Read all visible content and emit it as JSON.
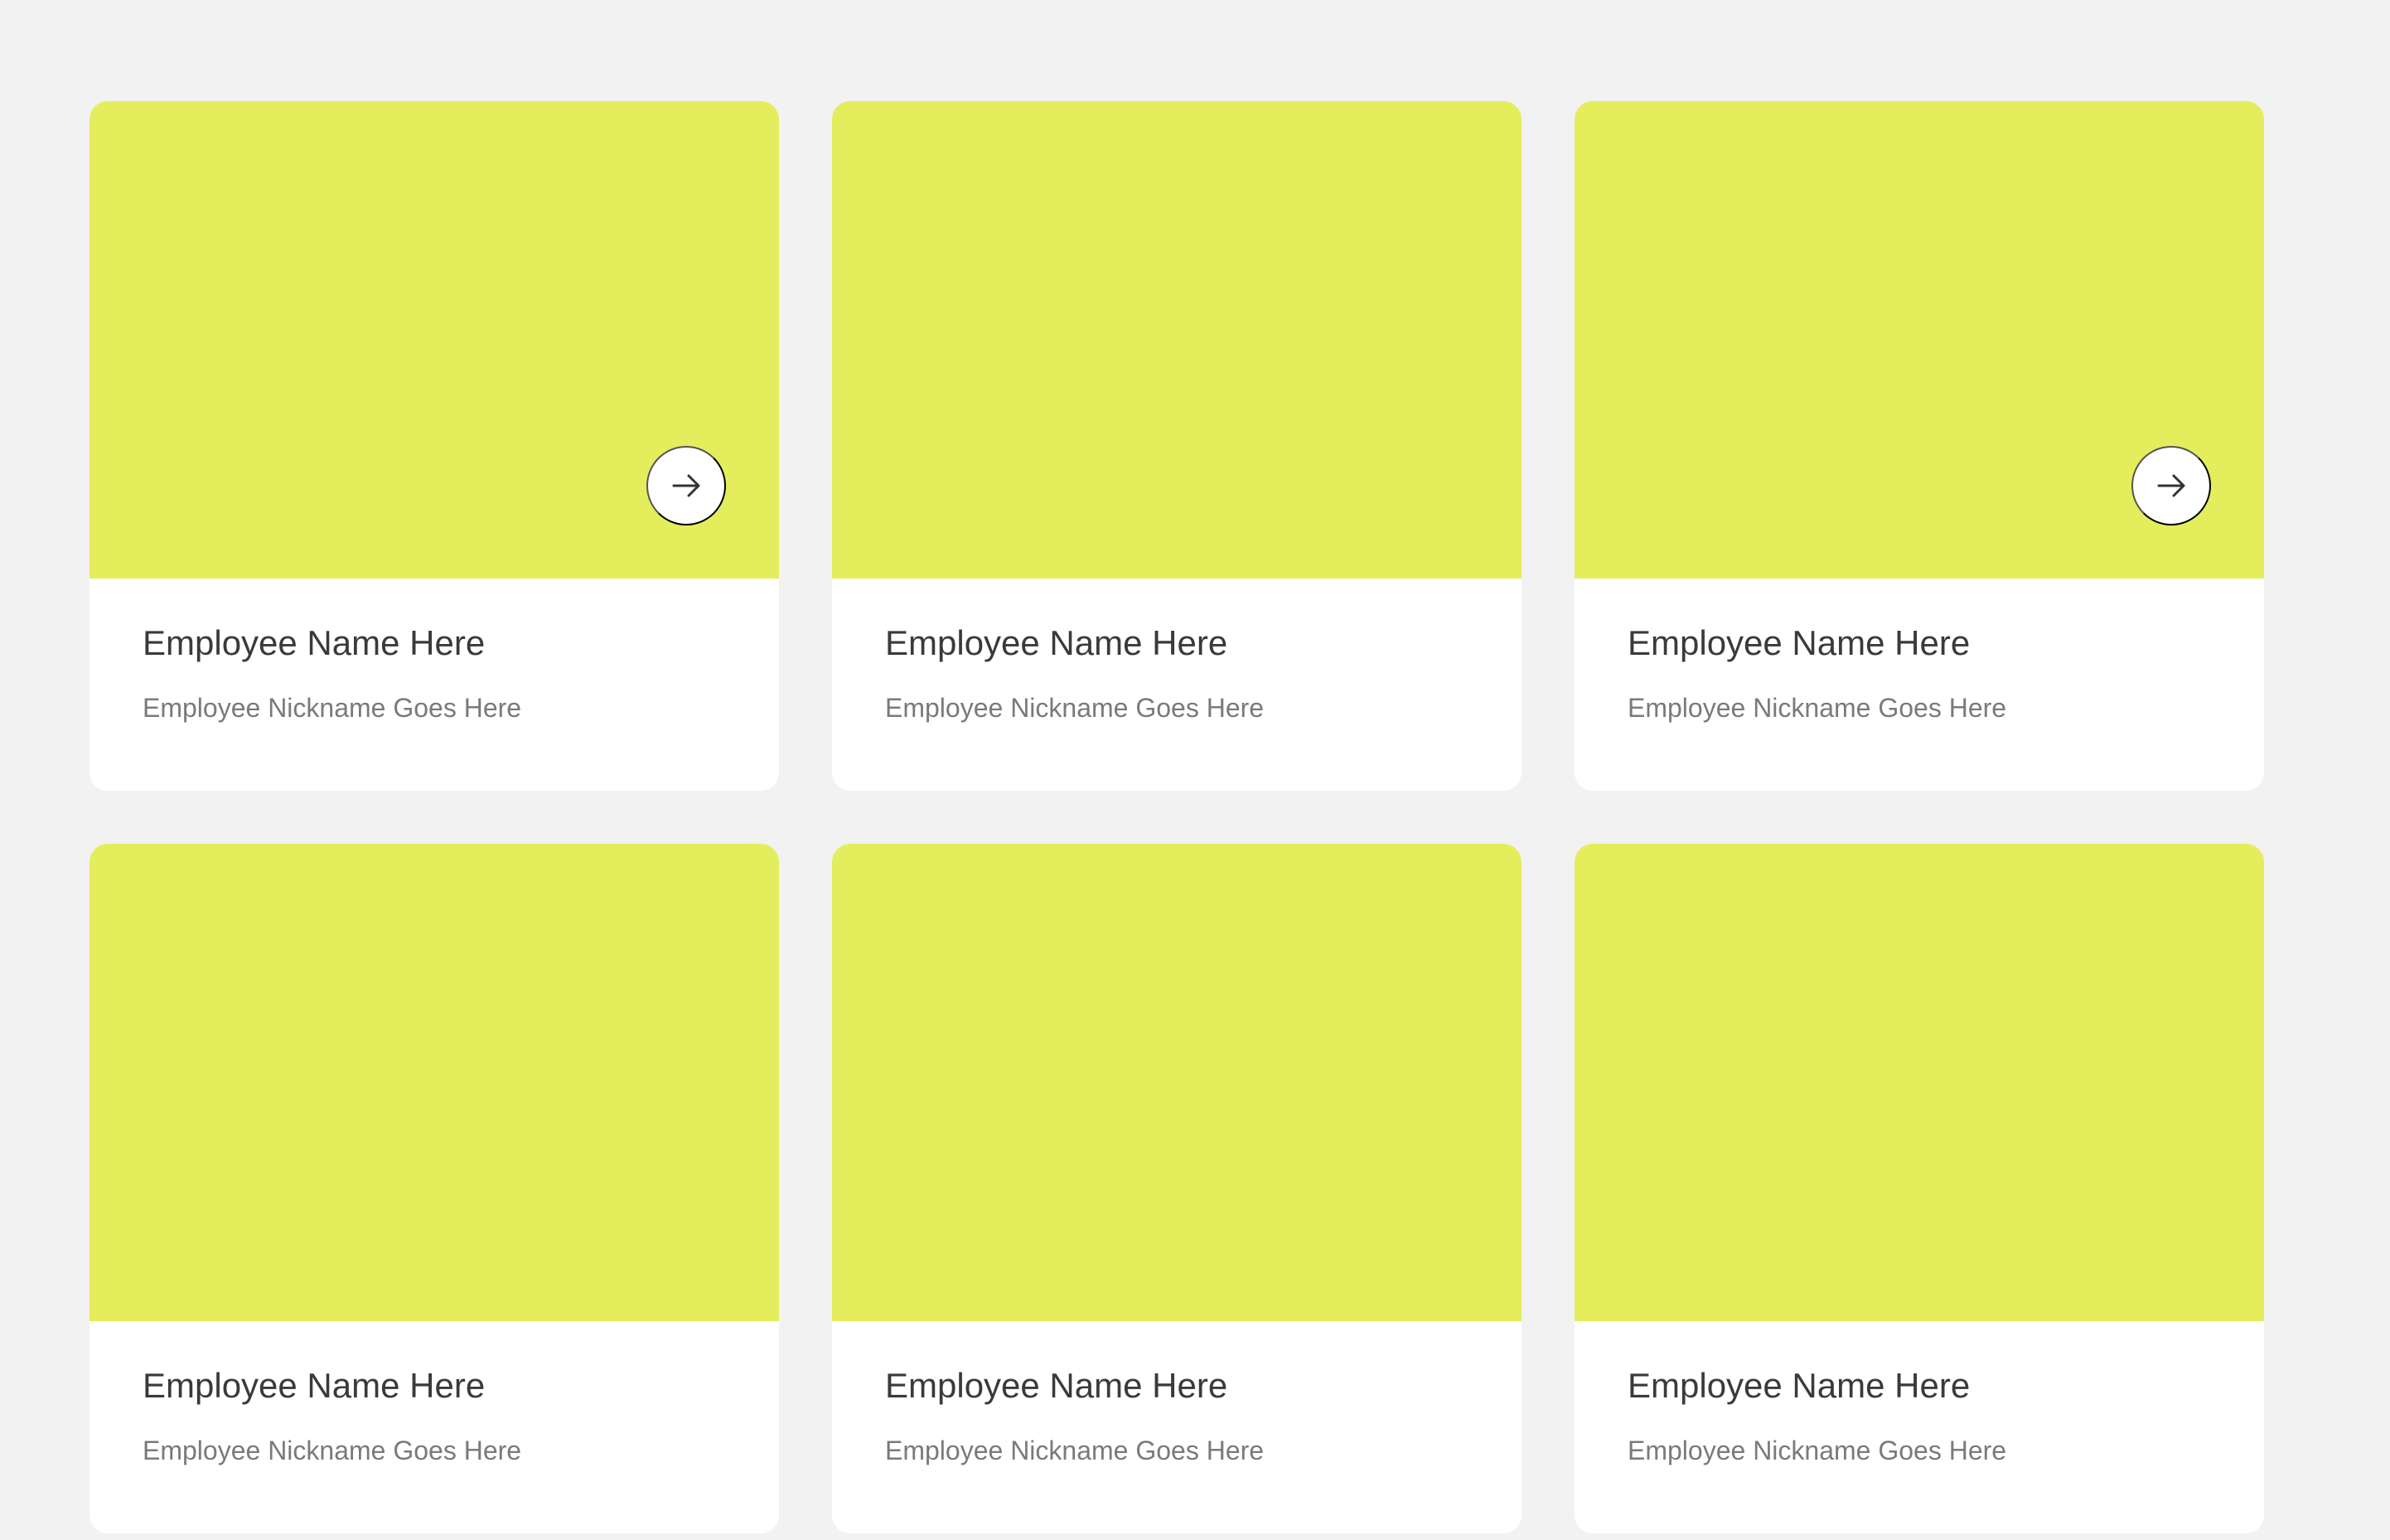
{
  "colors": {
    "page_background": "#f2f2f2",
    "card_media": "#e4ed5c",
    "card_body": "#ffffff",
    "title_text": "#3a3a3a",
    "subtitle_text": "#7a7a7a",
    "arrow_button": "#ffffff",
    "arrow_icon": "#333333"
  },
  "cards": [
    {
      "name": "Employee Name Here",
      "nickname": "Employee Nickname Goes Here",
      "action_icon": "arrow-right-icon",
      "show_action": true
    },
    {
      "name": "Employee Name Here",
      "nickname": "Employee Nickname Goes Here",
      "action_icon": "arrow-right-icon",
      "show_action": false
    },
    {
      "name": "Employee Name Here",
      "nickname": "Employee Nickname Goes Here",
      "action_icon": "arrow-right-icon",
      "show_action": true
    },
    {
      "name": "Employee Name Here",
      "nickname": "Employee Nickname Goes Here",
      "action_icon": "arrow-right-icon",
      "show_action": false
    },
    {
      "name": "Employee Name Here",
      "nickname": "Employee Nickname Goes Here",
      "action_icon": "arrow-right-icon",
      "show_action": false
    },
    {
      "name": "Employee Name Here",
      "nickname": "Employee Nickname Goes Here",
      "action_icon": "arrow-right-icon",
      "show_action": false
    }
  ]
}
